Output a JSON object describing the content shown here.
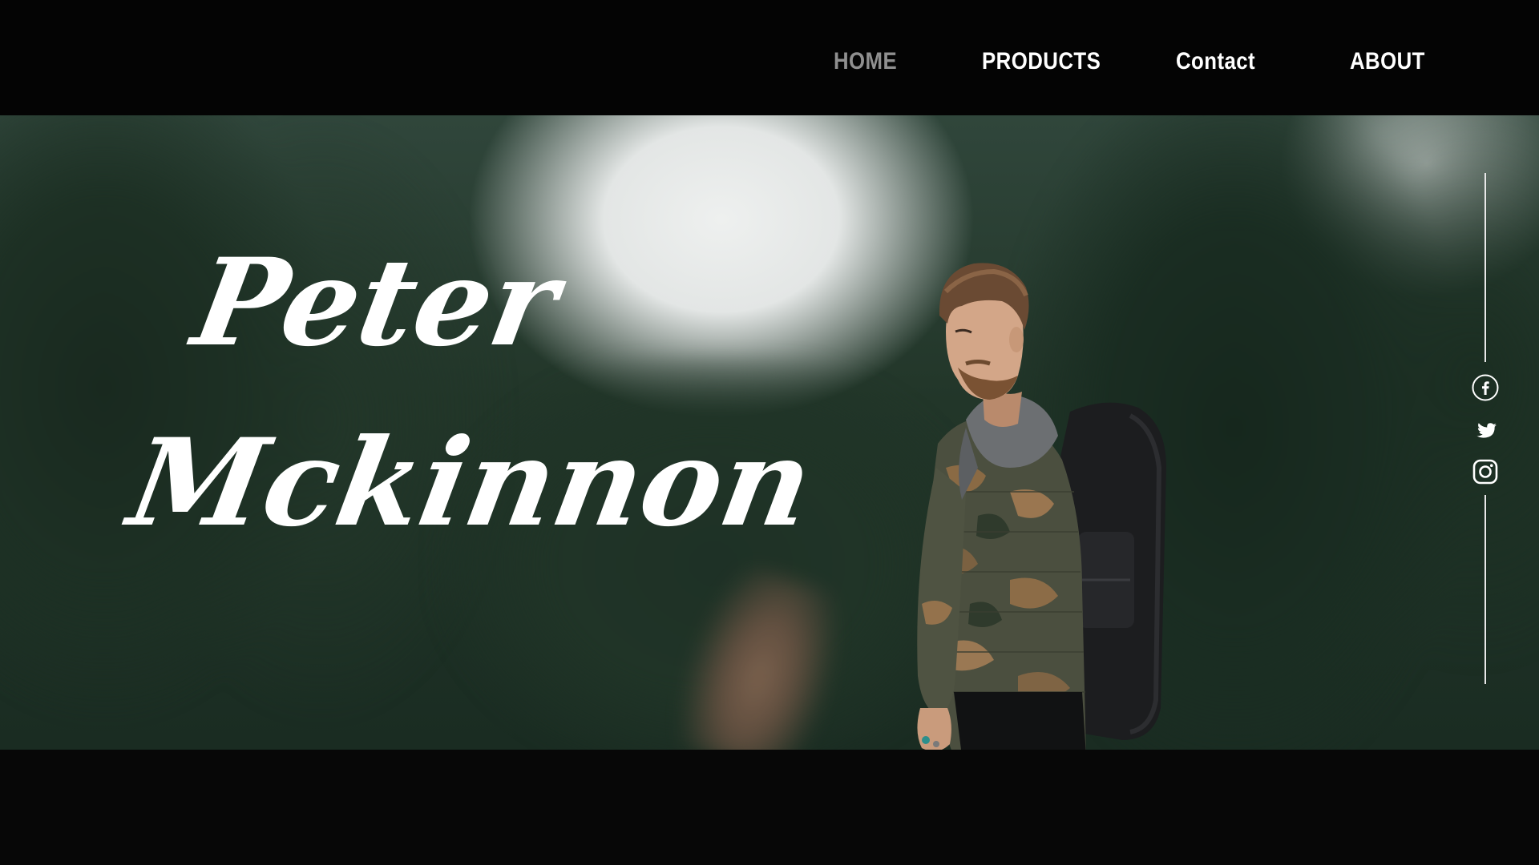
{
  "nav": {
    "items": [
      {
        "label": "HOME",
        "active": true
      },
      {
        "label": "PRODUCTS",
        "active": false
      },
      {
        "label": "Contact",
        "active": false
      },
      {
        "label": "ABOUT",
        "active": false
      }
    ]
  },
  "hero": {
    "first_name": "Peter",
    "last_name": "Mckinnon"
  },
  "social": {
    "icons": [
      "facebook-icon",
      "twitter-icon",
      "instagram-icon"
    ]
  },
  "colors": {
    "background": "#060606",
    "nav_active": "#8f8f8f",
    "nav_text": "#ffffff",
    "foliage": "#1d3024"
  }
}
